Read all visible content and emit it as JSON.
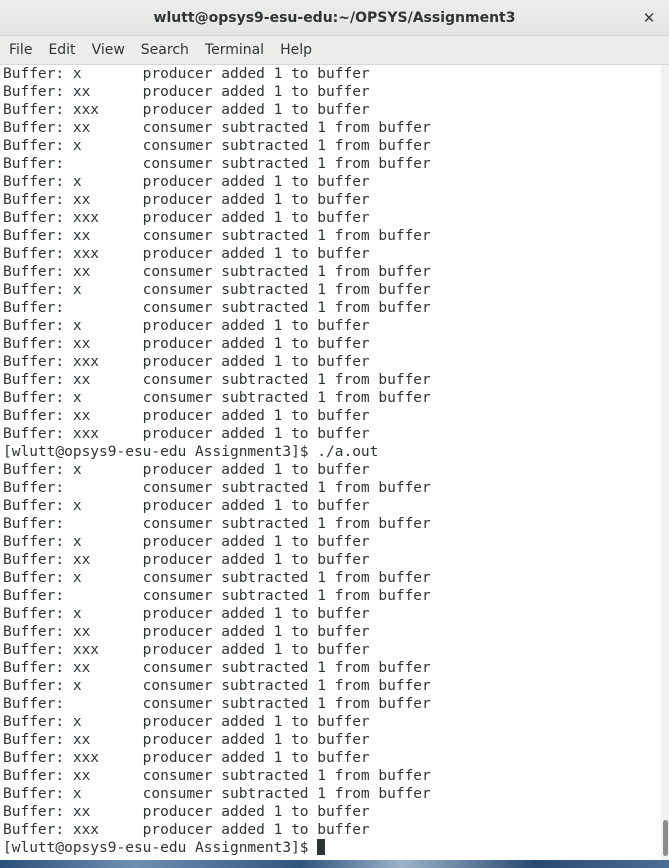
{
  "window": {
    "title": "wlutt@opsys9-esu-edu:~/OPSYS/Assignment3",
    "close_glyph": "✕"
  },
  "menu": {
    "items": [
      "File",
      "Edit",
      "View",
      "Search",
      "Terminal",
      "Help"
    ]
  },
  "terminal": {
    "lines": [
      "Buffer: x       producer added 1 to buffer",
      "Buffer: xx      producer added 1 to buffer",
      "Buffer: xxx     producer added 1 to buffer",
      "Buffer: xx      consumer subtracted 1 from buffer",
      "Buffer: x       consumer subtracted 1 from buffer",
      "Buffer:         consumer subtracted 1 from buffer",
      "Buffer: x       producer added 1 to buffer",
      "Buffer: xx      producer added 1 to buffer",
      "Buffer: xxx     producer added 1 to buffer",
      "Buffer: xx      consumer subtracted 1 from buffer",
      "Buffer: xxx     producer added 1 to buffer",
      "Buffer: xx      consumer subtracted 1 from buffer",
      "Buffer: x       consumer subtracted 1 from buffer",
      "Buffer:         consumer subtracted 1 from buffer",
      "Buffer: x       producer added 1 to buffer",
      "Buffer: xx      producer added 1 to buffer",
      "Buffer: xxx     producer added 1 to buffer",
      "Buffer: xx      consumer subtracted 1 from buffer",
      "Buffer: x       consumer subtracted 1 from buffer",
      "Buffer: xx      producer added 1 to buffer",
      "Buffer: xxx     producer added 1 to buffer",
      "[wlutt@opsys9-esu-edu Assignment3]$ ./a.out",
      "Buffer: x       producer added 1 to buffer",
      "Buffer:         consumer subtracted 1 from buffer",
      "Buffer: x       producer added 1 to buffer",
      "Buffer:         consumer subtracted 1 from buffer",
      "Buffer: x       producer added 1 to buffer",
      "Buffer: xx      producer added 1 to buffer",
      "Buffer: x       consumer subtracted 1 from buffer",
      "Buffer:         consumer subtracted 1 from buffer",
      "Buffer: x       producer added 1 to buffer",
      "Buffer: xx      producer added 1 to buffer",
      "Buffer: xxx     producer added 1 to buffer",
      "Buffer: xx      consumer subtracted 1 from buffer",
      "Buffer: x       consumer subtracted 1 from buffer",
      "Buffer:         consumer subtracted 1 from buffer",
      "Buffer: x       producer added 1 to buffer",
      "Buffer: xx      producer added 1 to buffer",
      "Buffer: xxx     producer added 1 to buffer",
      "Buffer: xx      consumer subtracted 1 from buffer",
      "Buffer: x       consumer subtracted 1 from buffer",
      "Buffer: xx      producer added 1 to buffer",
      "Buffer: xxx     producer added 1 to buffer"
    ],
    "prompt": "[wlutt@opsys9-esu-edu Assignment3]$ "
  }
}
